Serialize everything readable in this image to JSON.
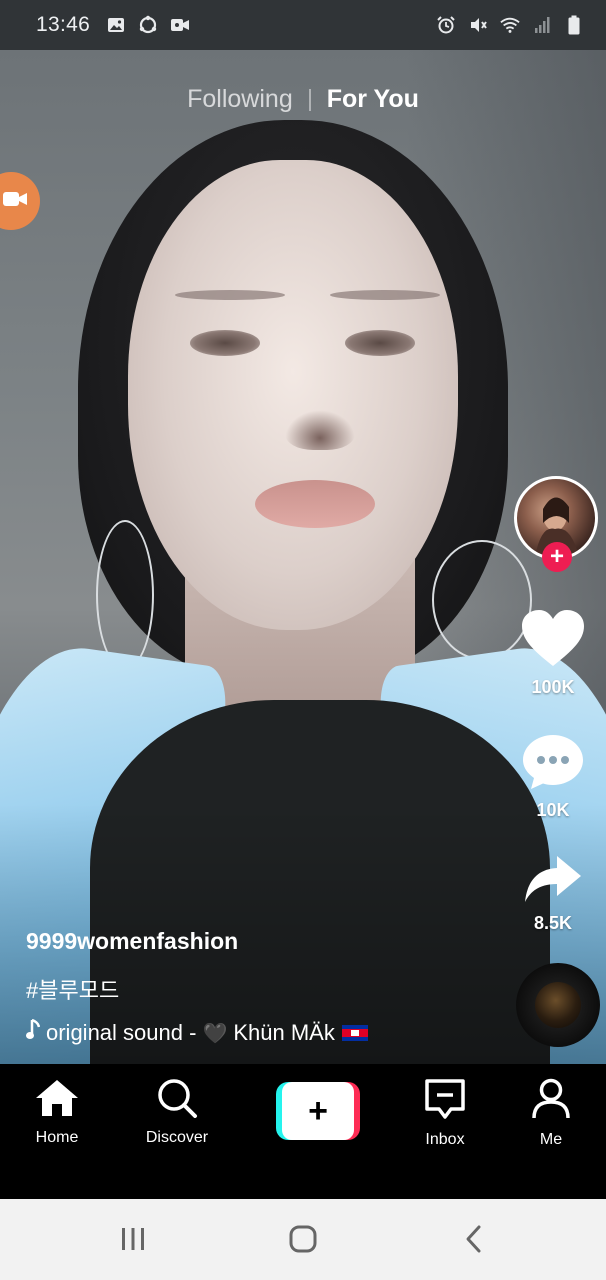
{
  "status_bar": {
    "time": "13:46",
    "left_icons": [
      "gallery-icon",
      "sync-icon",
      "video-icon"
    ],
    "right_icons": [
      "alarm-icon",
      "mute-icon",
      "wifi-icon",
      "signal-icon",
      "battery-icon"
    ]
  },
  "top_tabs": {
    "following": "Following",
    "for_you": "For You",
    "active": "For You"
  },
  "live_button": {
    "icon": "live-camera-icon"
  },
  "right_rail": {
    "avatar": {
      "icon": "avatar",
      "follow_icon": "plus-icon",
      "follow_symbol": "+"
    },
    "like": {
      "icon": "heart-icon",
      "count": "100K"
    },
    "comment": {
      "icon": "comment-icon",
      "count": "10K"
    },
    "share": {
      "icon": "share-icon",
      "count": "8.5K"
    },
    "sound_disc": {
      "icon": "music-disc-icon"
    }
  },
  "caption": {
    "username": "9999womenfashion",
    "hashtag": "#블루모드",
    "sound_prefix": "original sound - ",
    "sound_heart": "🖤",
    "sound_author": "Khün MÄk",
    "sound_flag": "cambodia-flag-icon"
  },
  "bottom_nav": {
    "items": [
      {
        "label": "Home",
        "icon": "home-icon"
      },
      {
        "label": "Discover",
        "icon": "search-icon"
      },
      {
        "label": "",
        "icon": "plus-icon"
      },
      {
        "label": "Inbox",
        "icon": "inbox-icon"
      },
      {
        "label": "Me",
        "icon": "profile-icon"
      }
    ],
    "create_symbol": "+"
  },
  "system_nav": {
    "buttons": [
      "recents-icon",
      "home-circle-icon",
      "back-icon"
    ]
  },
  "colors": {
    "accent_red": "#fe2c55",
    "accent_cyan": "#25f4ee",
    "follow_red": "#ee1d52",
    "status_bar_bg": "#303437",
    "live_orange": "#e8874a"
  }
}
